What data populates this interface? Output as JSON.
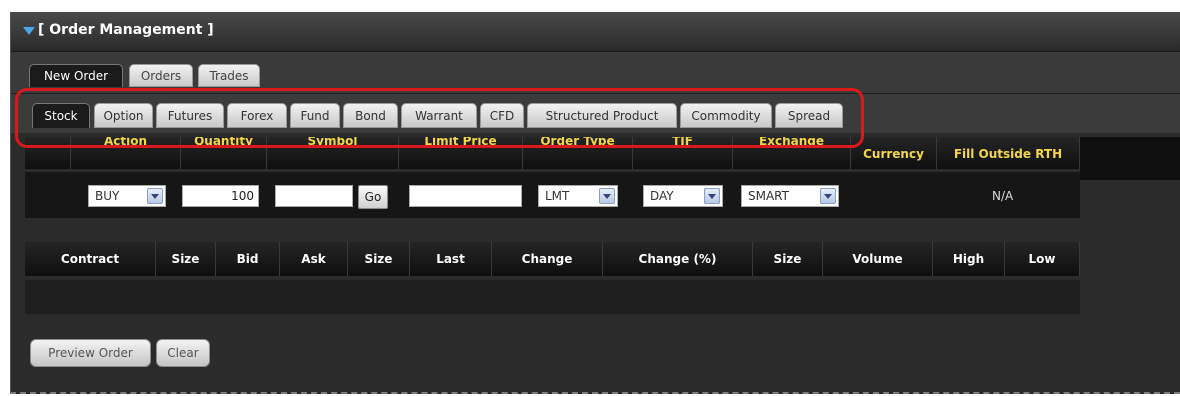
{
  "panel": {
    "title": "[ Order Management ]"
  },
  "top_tabs": [
    {
      "label": "New Order",
      "active": true
    },
    {
      "label": "Orders",
      "active": false
    },
    {
      "label": "Trades",
      "active": false
    }
  ],
  "sub_tabs": [
    {
      "label": "Stock",
      "active": true
    },
    {
      "label": "Option",
      "active": false
    },
    {
      "label": "Futures",
      "active": false
    },
    {
      "label": "Forex",
      "active": false
    },
    {
      "label": "Fund",
      "active": false
    },
    {
      "label": "Bond",
      "active": false
    },
    {
      "label": "Warrant",
      "active": false
    },
    {
      "label": "CFD",
      "active": false
    },
    {
      "label": "Structured Product",
      "active": false
    },
    {
      "label": "Commodity",
      "active": false
    },
    {
      "label": "Spread",
      "active": false
    }
  ],
  "order_columns": [
    "Action",
    "Quantity",
    "Symbol",
    "Limit Price",
    "Order Type",
    "TIF",
    "Exchange",
    "Currency",
    "Fill Outside RTH"
  ],
  "order_row": {
    "action": "BUY",
    "quantity": "100",
    "symbol": "",
    "go_label": "Go",
    "limit_price": "",
    "order_type": "LMT",
    "tif": "DAY",
    "exchange": "SMART",
    "fill_outside_rth": "N/A"
  },
  "market_columns": [
    "Contract",
    "Size",
    "Bid",
    "Ask",
    "Size",
    "Last",
    "Change",
    "Change (%)",
    "Size",
    "Volume",
    "High",
    "Low"
  ],
  "buttons": {
    "preview_order": "Preview Order",
    "clear": "Clear"
  },
  "colors": {
    "header_text": "#f3d64a",
    "highlight": "#d9191c",
    "title_arrow": "#4aa8e8"
  }
}
